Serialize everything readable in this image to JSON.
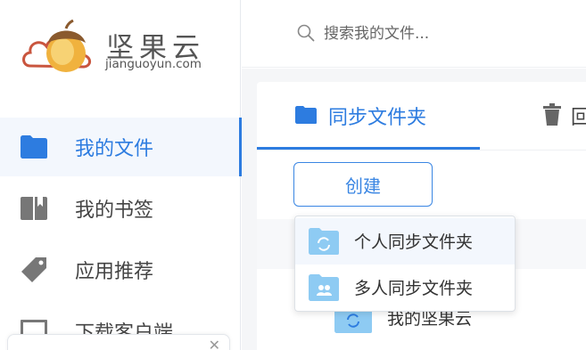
{
  "brand": {
    "name": "坚果云",
    "domain": "jianguoyun.com"
  },
  "search": {
    "placeholder": "搜索我的文件..."
  },
  "sidebar": {
    "items": [
      {
        "label": "我的文件",
        "icon": "folder-icon",
        "active": true
      },
      {
        "label": "我的书签",
        "icon": "bookmark-icon",
        "active": false
      },
      {
        "label": "应用推荐",
        "icon": "tag-icon",
        "active": false
      },
      {
        "label": "下载客户端",
        "icon": "monitor-icon",
        "active": false
      }
    ]
  },
  "tabs": [
    {
      "label": "同步文件夹",
      "icon": "folder-icon",
      "active": true
    },
    {
      "label": "回",
      "icon": "trash-icon",
      "active": false
    }
  ],
  "toolbar": {
    "create_label": "创建"
  },
  "dropdown": {
    "items": [
      {
        "label": "个人同步文件夹",
        "icon": "personal-sync-folder-icon"
      },
      {
        "label": "多人同步文件夹",
        "icon": "shared-sync-folder-icon"
      }
    ]
  },
  "file_list": [
    {
      "label": "我的坚果云",
      "icon": "sync-folder-icon"
    }
  ],
  "colors": {
    "accent": "#2d7ce0",
    "folder_light": "#8ecbf3"
  }
}
